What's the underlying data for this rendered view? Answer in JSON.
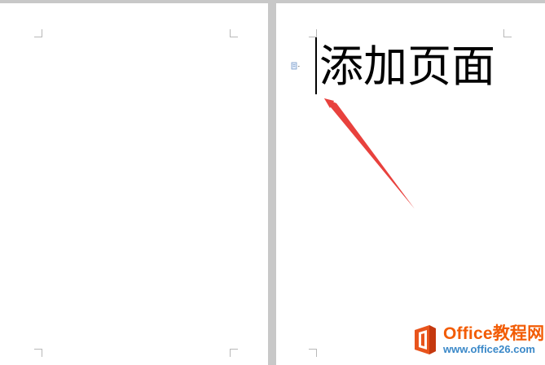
{
  "document": {
    "text": "添加页面"
  },
  "icons": {
    "paste_options": "paste-options-icon",
    "logo": "office-logo-icon"
  },
  "annotation": {
    "arrow_color": "#e8413d"
  },
  "watermark": {
    "title": "Office教程网",
    "url": "www.office26.com",
    "title_color": "#f25c05",
    "url_color": "#3a88c8"
  }
}
